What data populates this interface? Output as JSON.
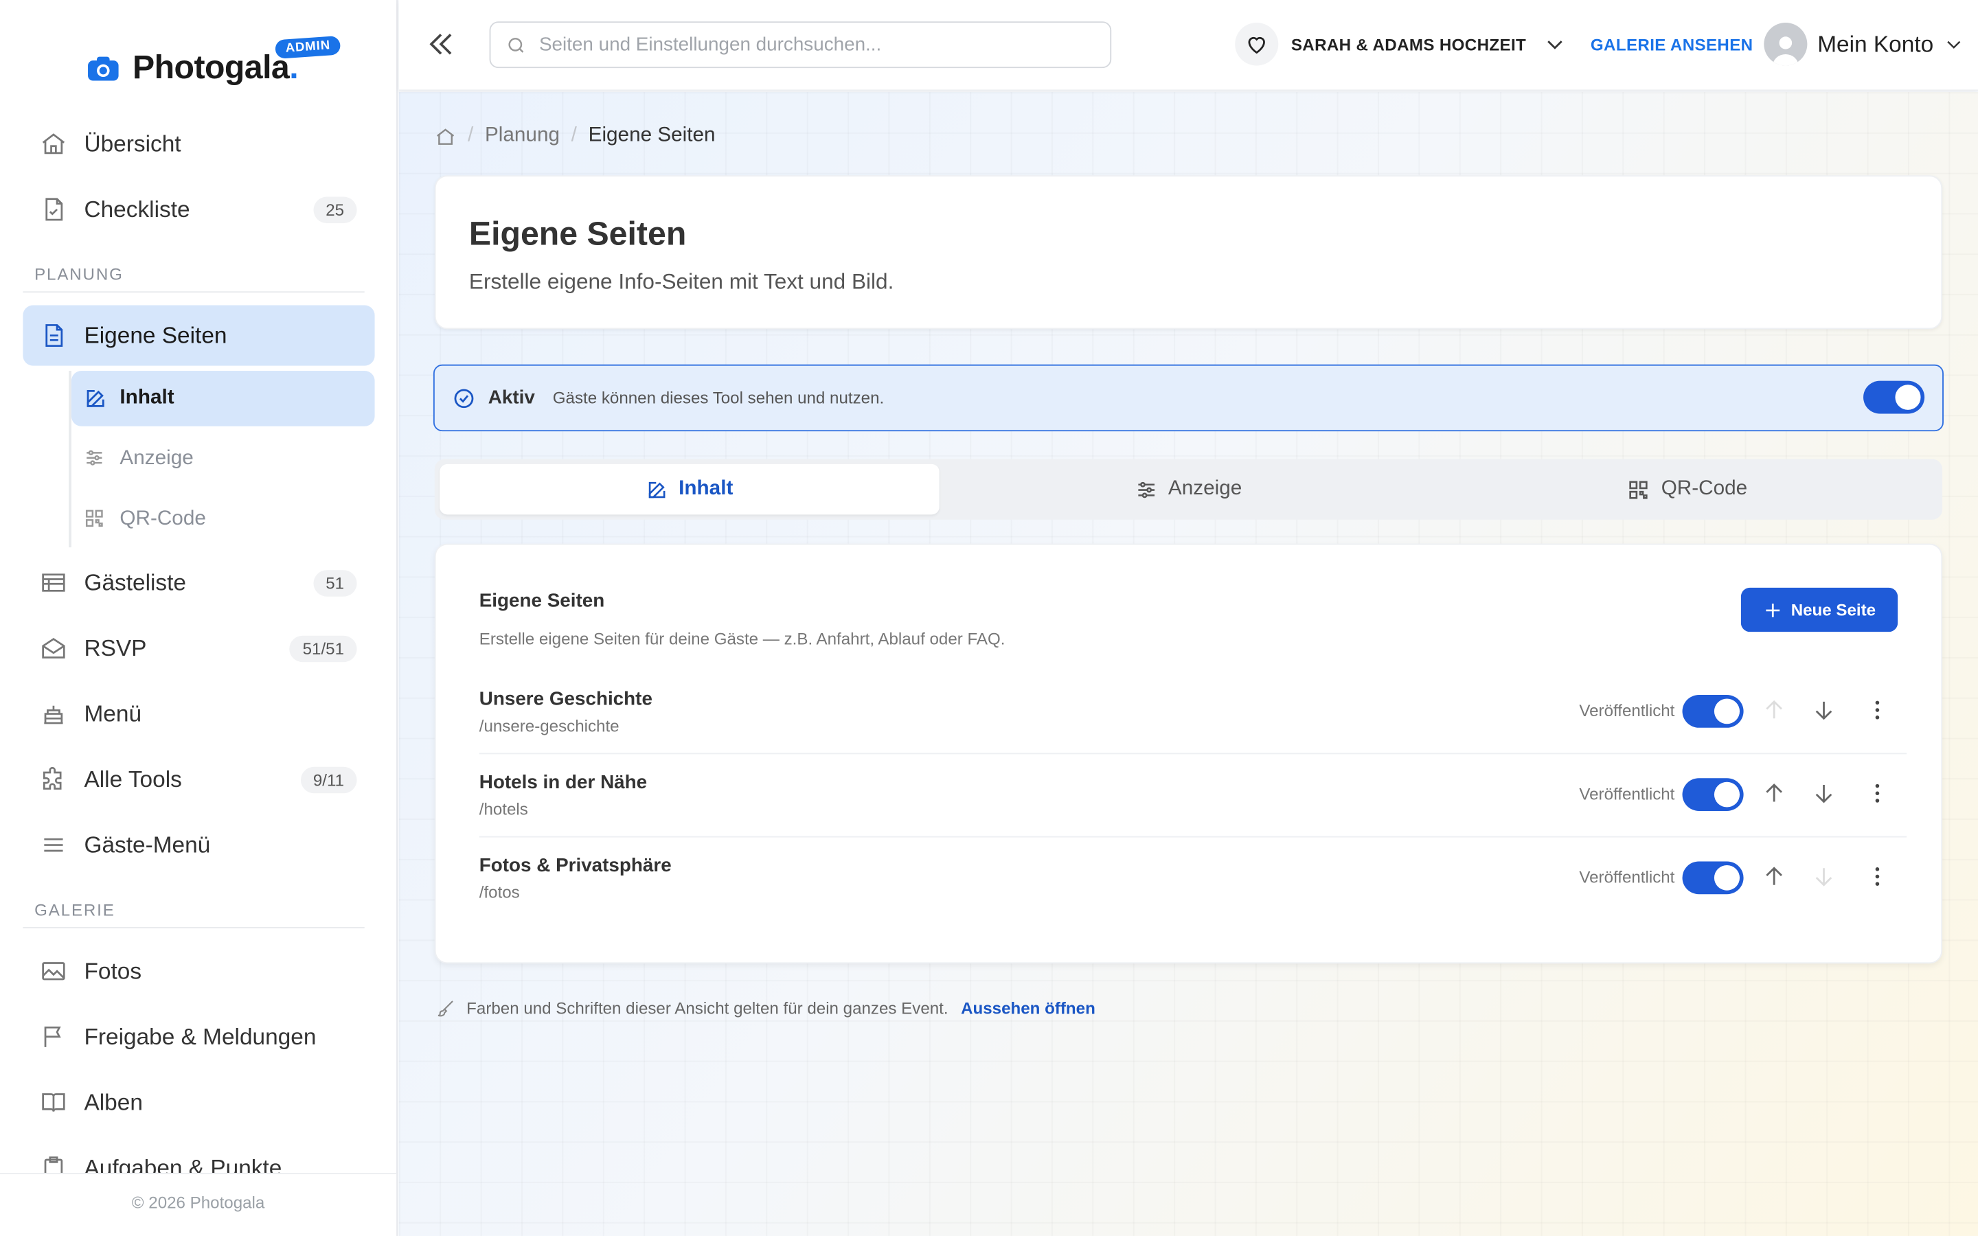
{
  "brand": {
    "name": "Photogala",
    "dot": ".",
    "badge": "ADMIN",
    "accent": "#1a73e8"
  },
  "sidebar": {
    "items_top": [
      {
        "label": "Übersicht",
        "icon": "home-icon"
      },
      {
        "label": "Checkliste",
        "icon": "checklist-icon",
        "count": "25"
      }
    ],
    "section_planung": "PLANUNG",
    "active_item": {
      "label": "Eigene Seiten",
      "icon": "document-icon"
    },
    "subitems": [
      {
        "label": "Inhalt",
        "icon": "edit-icon"
      },
      {
        "label": "Anzeige",
        "icon": "sliders-icon"
      },
      {
        "label": "QR-Code",
        "icon": "qr-code-icon"
      }
    ],
    "items_planung": [
      {
        "label": "Gästeliste",
        "icon": "table-icon",
        "count": "51"
      },
      {
        "label": "RSVP",
        "icon": "envelope-open-icon",
        "count": "51/51"
      },
      {
        "label": "Menü",
        "icon": "cake-icon"
      },
      {
        "label": "Alle Tools",
        "icon": "puzzle-icon",
        "count": "9/11"
      },
      {
        "label": "Gäste-Menü",
        "icon": "menu-icon"
      }
    ],
    "section_galerie": "GALERIE",
    "items_galerie": [
      {
        "label": "Fotos",
        "icon": "image-icon"
      },
      {
        "label": "Freigabe & Meldungen",
        "icon": "flag-icon"
      },
      {
        "label": "Alben",
        "icon": "book-icon"
      },
      {
        "label": "Aufgaben & Punkte",
        "icon": "clipboard-icon"
      }
    ],
    "footer": "© 2026 Photogala"
  },
  "topbar": {
    "search_placeholder": "Seiten und Einstellungen durchsuchen...",
    "event_name": "SARAH & ADAMS HOCHZEIT",
    "gallery_link": "GALERIE ANSEHEN",
    "account_label": "Mein Konto"
  },
  "breadcrumb": {
    "parent": "Planung",
    "current": "Eigene Seiten"
  },
  "header": {
    "title": "Eigene Seiten",
    "subtitle": "Erstelle eigene Info-Seiten mit Text und Bild."
  },
  "active_bar": {
    "label": "Aktiv",
    "description": "Gäste können dieses Tool sehen und nutzen.",
    "enabled": true
  },
  "tabs": [
    {
      "label": "Inhalt",
      "icon": "edit-icon",
      "active": true
    },
    {
      "label": "Anzeige",
      "icon": "sliders-icon",
      "active": false
    },
    {
      "label": "QR-Code",
      "icon": "qr-code-icon",
      "active": false
    }
  ],
  "pages_card": {
    "title": "Eigene Seiten",
    "description": "Erstelle eigene Seiten für deine Gäste — z.B. Anfahrt, Ablauf oder FAQ.",
    "new_button": "Neue Seite",
    "status_label": "Veröffentlicht",
    "rows": [
      {
        "name": "Unsere Geschichte",
        "slug": "/unsere-geschichte",
        "published": true,
        "can_move_up": false,
        "can_move_down": true
      },
      {
        "name": "Hotels in der Nähe",
        "slug": "/hotels",
        "published": true,
        "can_move_up": true,
        "can_move_down": true
      },
      {
        "name": "Fotos & Privatsphäre",
        "slug": "/fotos",
        "published": true,
        "can_move_up": true,
        "can_move_down": false
      }
    ]
  },
  "footer_hint": {
    "text": "Farben und Schriften dieser Ansicht gelten für dein ganzes Event.",
    "link": "Aussehen öffnen"
  },
  "colors": {
    "primary": "#1f5bd8",
    "active_bg": "#d6e6fb",
    "link": "#1a56c4"
  }
}
